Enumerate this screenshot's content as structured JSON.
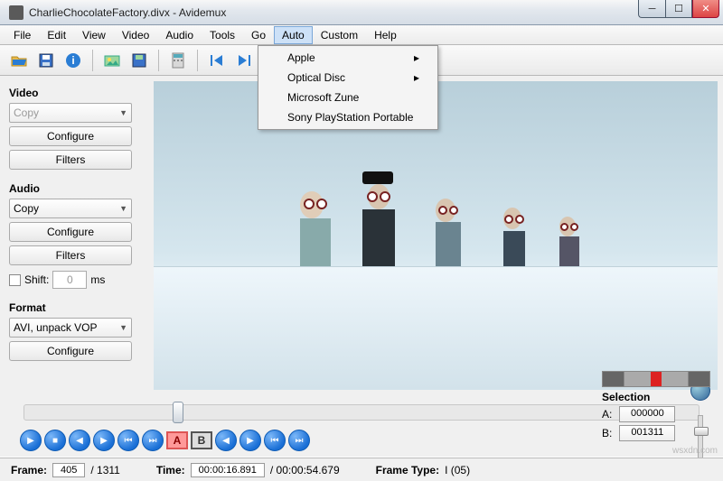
{
  "window": {
    "title": "CharlieChocolateFactory.divx - Avidemux"
  },
  "menu": {
    "items": [
      "File",
      "Edit",
      "View",
      "Video",
      "Audio",
      "Tools",
      "Go",
      "Auto",
      "Custom",
      "Help"
    ],
    "active": "Auto",
    "dropdown": [
      {
        "label": "Apple",
        "submenu": true
      },
      {
        "label": "Optical Disc",
        "submenu": true
      },
      {
        "label": "Microsoft Zune",
        "submenu": false
      },
      {
        "label": "Sony PlayStation Portable",
        "submenu": false
      }
    ]
  },
  "sidebar": {
    "video": {
      "label": "Video",
      "codec": "Copy",
      "configure": "Configure",
      "filters": "Filters"
    },
    "audio": {
      "label": "Audio",
      "codec": "Copy",
      "configure": "Configure",
      "filters": "Filters",
      "shift_label": "Shift:",
      "shift_value": "0",
      "shift_unit": "ms"
    },
    "format": {
      "label": "Format",
      "value": "AVI, unpack VOP",
      "configure": "Configure"
    }
  },
  "selection": {
    "header": "Selection",
    "a_label": "A:",
    "a_value": "000000",
    "b_label": "B:",
    "b_value": "001311"
  },
  "status": {
    "frame_label": "Frame:",
    "frame_value": "405",
    "frame_total": "/ 1311",
    "time_label": "Time:",
    "time_value": "00:00:16.891",
    "time_total": "/ 00:00:54.679",
    "type_label": "Frame Type:",
    "type_value": "I (05)"
  },
  "watermark": "wsxdn.com"
}
